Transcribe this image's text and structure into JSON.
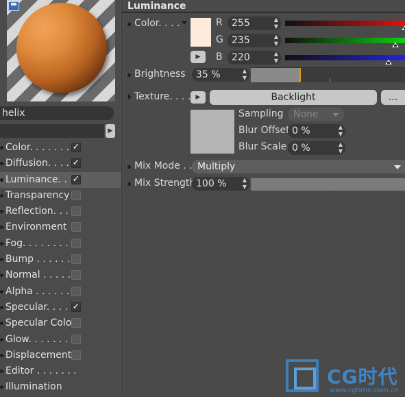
{
  "preview": {
    "sphere_color": "#e08a3c"
  },
  "material": {
    "name": "helix",
    "sub_field": ""
  },
  "channels": [
    {
      "label": "Color. . . . . . . .",
      "checked": true
    },
    {
      "label": "Diffusion. . . . .",
      "checked": true
    },
    {
      "label": "Luminance. . . .",
      "checked": true,
      "active": true
    },
    {
      "label": "Transparency",
      "checked": false
    },
    {
      "label": "Reflection. . . .",
      "checked": false
    },
    {
      "label": "Environment",
      "checked": false
    },
    {
      "label": "Fog. . . . . . . . .",
      "checked": false
    },
    {
      "label": "Bump . . . . . . .",
      "checked": false
    },
    {
      "label": "Normal . . . . . .",
      "checked": false
    },
    {
      "label": "Alpha . . . . . . .",
      "checked": false
    },
    {
      "label": "Specular. . . . .",
      "checked": true
    },
    {
      "label": "Specular Color",
      "checked": false
    },
    {
      "label": "Glow. . . . . . . .",
      "checked": false
    },
    {
      "label": "Displacement",
      "checked": false
    },
    {
      "label": "Editor . . . . . . .",
      "checked": null
    },
    {
      "label": "Illumination",
      "checked": null
    }
  ],
  "panel": {
    "title": "Luminance",
    "color_label": "Color. . . .",
    "color_swatch": "#ffebdc",
    "r_label": "R",
    "g_label": "G",
    "b_label": "B",
    "r_value": "255",
    "g_value": "235",
    "b_value": "220",
    "brightness_label": "Brightness",
    "brightness_value": "35 %",
    "texture_label": "Texture. . . .",
    "texture_name": "Backlight",
    "texture_more": "...",
    "sampling_label": "Sampling",
    "sampling_value": "None",
    "blur_offset_label": "Blur Offset",
    "blur_offset_value": "0 %",
    "blur_scale_label": "Blur Scale",
    "blur_scale_value": "0 %",
    "mix_mode_label": "Mix Mode . .",
    "mix_mode_value": "Multiply",
    "mix_strength_label": "Mix Strength",
    "mix_strength_value": "100 %",
    "brightness_level": 0.35,
    "mix_strength_level": 1.0,
    "r_level": 1.0,
    "g_level": 0.92,
    "b_level": 0.86
  },
  "colors": {
    "r_slider": "#d11",
    "g_slider": "#1c1",
    "b_slider": "#22d",
    "accent": "#e09a1a"
  },
  "watermark": {
    "text": "CG时代",
    "url": "www.cgtime.com.cn"
  }
}
